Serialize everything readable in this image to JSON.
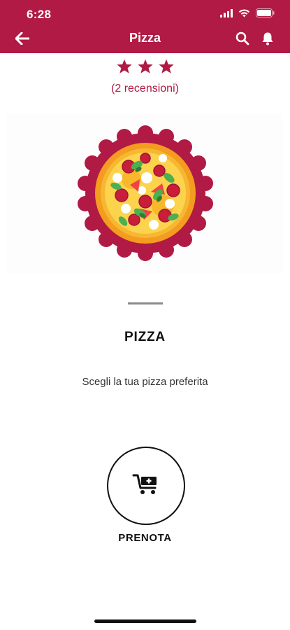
{
  "status_bar": {
    "time": "6:28"
  },
  "app_bar": {
    "title": "Pizza",
    "back_icon": "arrow-left-icon",
    "search_icon": "search-icon",
    "notification_icon": "bell-icon"
  },
  "rating": {
    "stars": 3,
    "reviews_label": "(2 recensioni)"
  },
  "product": {
    "title": "PIZZA",
    "description": "Scegli la tua pizza preferita"
  },
  "action": {
    "label": "PRENOTA",
    "icon": "cart-add-icon"
  },
  "colors": {
    "brand": "#b01a44",
    "text": "#111111"
  }
}
